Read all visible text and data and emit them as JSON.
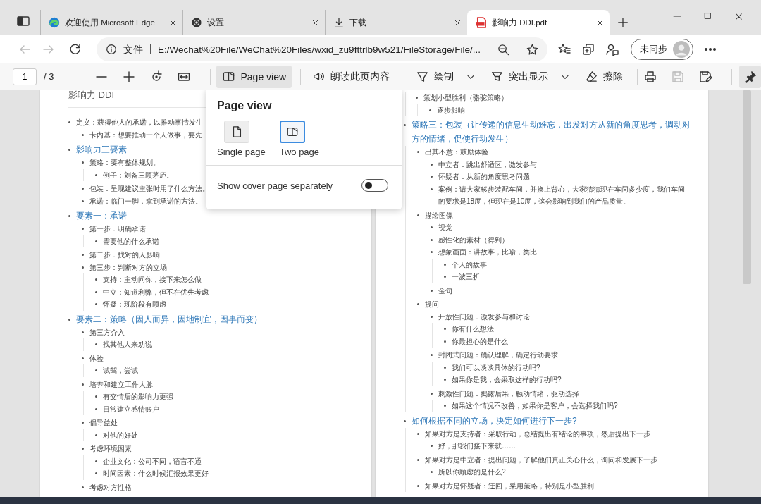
{
  "tabs": [
    {
      "title": "欢迎使用 Microsoft Edge",
      "selected": false
    },
    {
      "title": "设置",
      "selected": false
    },
    {
      "title": "下载",
      "selected": false
    },
    {
      "title": "影响力 DDI.pdf",
      "selected": true
    }
  ],
  "address_bar": {
    "back_disabled": true,
    "forward_disabled": true,
    "scheme_label": "文件",
    "url": "E:/Wechat%20File/WeChat%20Files/wxid_zu9fttrlb9w521/FileStorage/File/...",
    "sync_button": "未同步"
  },
  "pdf_toolbar": {
    "page_number": "1",
    "page_count": "/ 3",
    "page_view": {
      "label": "Page view",
      "pressed": true
    },
    "read_aloud": "朗读此页内容",
    "draw": "绘制",
    "highlight": "突出显示",
    "erase": "擦除",
    "save_disabled": true,
    "pin_pressed": true
  },
  "page_view_menu": {
    "title": "Page view",
    "options": [
      {
        "label": "Single page",
        "selected": false
      },
      {
        "label": "Two page",
        "selected": true
      }
    ],
    "cover_toggle": {
      "label": "Show cover page separately",
      "on": false
    }
  },
  "pages": [
    {
      "title": "影响力 DDI",
      "items": [
        {
          "kind": "item",
          "text": "定义：获得他人的承诺，以推动事情发生",
          "children": [
            {
              "kind": "item",
              "text": "卡内基：想要推动一个人做事，要先"
            }
          ]
        },
        {
          "kind": "heading",
          "text": "影响力三要素",
          "children": [
            {
              "kind": "item",
              "text": "策略：要有整体规划。",
              "children": [
                {
                  "kind": "item",
                  "text": "例子：刘备三顾茅庐。"
                }
              ]
            },
            {
              "kind": "item",
              "text": "包装：呈现建议主张时用了什么方法。"
            },
            {
              "kind": "item",
              "text": "承诺：临门一脚，拿到承诺的方法。"
            }
          ]
        },
        {
          "kind": "heading",
          "text": "要素一：承诺",
          "children": [
            {
              "kind": "item",
              "text": "第一步：明确承诺",
              "children": [
                {
                  "kind": "item",
                  "text": "需要他的什么承诺"
                }
              ]
            },
            {
              "kind": "item",
              "text": "第二步：找对的人影响"
            },
            {
              "kind": "item",
              "text": "第三步：判断对方的立场",
              "children": [
                {
                  "kind": "item",
                  "text": "支持：主动问你，接下来怎么做"
                },
                {
                  "kind": "item",
                  "text": "中立：知道利弊，但不在优先考虑"
                },
                {
                  "kind": "item",
                  "text": "怀疑：现阶段有顾虑"
                }
              ]
            }
          ]
        },
        {
          "kind": "heading",
          "text": "要素二：策略（因人而异，因地制宜，因事而变）",
          "children": [
            {
              "kind": "item",
              "text": "第三方介入",
              "children": [
                {
                  "kind": "item",
                  "text": "找其他人来劝说"
                }
              ]
            },
            {
              "kind": "item",
              "text": "体验",
              "children": [
                {
                  "kind": "item",
                  "text": "试驾，尝试"
                }
              ]
            },
            {
              "kind": "item",
              "text": "培养和建立工作人脉",
              "children": [
                {
                  "kind": "item",
                  "text": "有交情后的影响力更强"
                },
                {
                  "kind": "item",
                  "text": "日常建立感情账户"
                }
              ]
            },
            {
              "kind": "item",
              "text": "倡导益处",
              "children": [
                {
                  "kind": "item",
                  "text": "对他的好处"
                }
              ]
            },
            {
              "kind": "item",
              "text": "考虑环境因素",
              "children": [
                {
                  "kind": "item",
                  "text": "企业文化：公司不同，语言不通"
                },
                {
                  "kind": "item",
                  "text": "时间因素：什么时候汇报效果更好"
                }
              ]
            },
            {
              "kind": "item",
              "text": "考虑对方性格"
            }
          ]
        }
      ]
    },
    {
      "items": [
        {
          "kind": "continuation",
          "children": [
            {
              "kind": "item",
              "text": "策划小型胜利（骆驼策略）",
              "children": [
                {
                  "kind": "item",
                  "text": "逐步影响"
                }
              ]
            }
          ]
        },
        {
          "kind": "heading",
          "text": "策略三：包装（让传递的信息生动难忘，出发对方从新的角度思考，调动对方的情绪，促使行动发生）",
          "children": [
            {
              "kind": "item",
              "text": "出其不意：鼓励体验",
              "children": [
                {
                  "kind": "item",
                  "text": "中立者：跳出舒适区，激发参与"
                },
                {
                  "kind": "item",
                  "text": "怀疑者：从新的角度思考问题"
                },
                {
                  "kind": "item",
                  "text": "案例：请大家移步装配车间，并换上背心，大家猜猜现在车间多少度，我们车间的要求是18度，但现在是10度，这会影响到我们的产品质量。"
                }
              ]
            },
            {
              "kind": "item",
              "text": "描绘图像",
              "children": [
                {
                  "kind": "item",
                  "text": "视觉"
                },
                {
                  "kind": "item",
                  "text": "感性化的素材（得到）"
                },
                {
                  "kind": "item",
                  "text": "想象画面：讲故事，比喻，类比",
                  "children": [
                    {
                      "kind": "item",
                      "text": "个人的故事"
                    },
                    {
                      "kind": "item",
                      "text": "一波三折"
                    }
                  ]
                },
                {
                  "kind": "item",
                  "text": "金句"
                }
              ]
            },
            {
              "kind": "item",
              "text": "提问",
              "children": [
                {
                  "kind": "item",
                  "text": "开放性问题：激发参与和讨论",
                  "children": [
                    {
                      "kind": "item",
                      "text": "你有什么想法"
                    },
                    {
                      "kind": "item",
                      "text": "你最担心的是什么"
                    }
                  ]
                },
                {
                  "kind": "item",
                  "text": "封闭式问题：确认理解，确定行动要求",
                  "children": [
                    {
                      "kind": "item",
                      "text": "我们可以谈谈具体的行动吗?"
                    },
                    {
                      "kind": "item",
                      "text": "如果你是我，会采取这样的行动吗?"
                    }
                  ]
                },
                {
                  "kind": "item",
                  "text": "刺激性问题：揭露后果，触动情绪，驱动选择",
                  "children": [
                    {
                      "kind": "item",
                      "text": "如果这个情况不改善，如果你是客户，会选择我们吗?"
                    }
                  ]
                }
              ]
            }
          ]
        },
        {
          "kind": "heading",
          "text": "如何根据不同的立场，决定如何进行下一步?",
          "children": [
            {
              "kind": "item",
              "text": "如果对方是支持者：采取行动，总结提出有结论的事项，然后提出下一步",
              "children": [
                {
                  "kind": "item",
                  "text": "好，那我们接下来就……"
                }
              ]
            },
            {
              "kind": "item",
              "text": "如果对方是中立者：提出问题，了解他们真正关心什么，询问和发展下一步",
              "children": [
                {
                  "kind": "item",
                  "text": "所以你顾虑的是什么?"
                }
              ]
            },
            {
              "kind": "item",
              "text": "如果对方是怀疑者：迂回，采用策略，特别是小型胜利"
            }
          ]
        }
      ]
    }
  ]
}
